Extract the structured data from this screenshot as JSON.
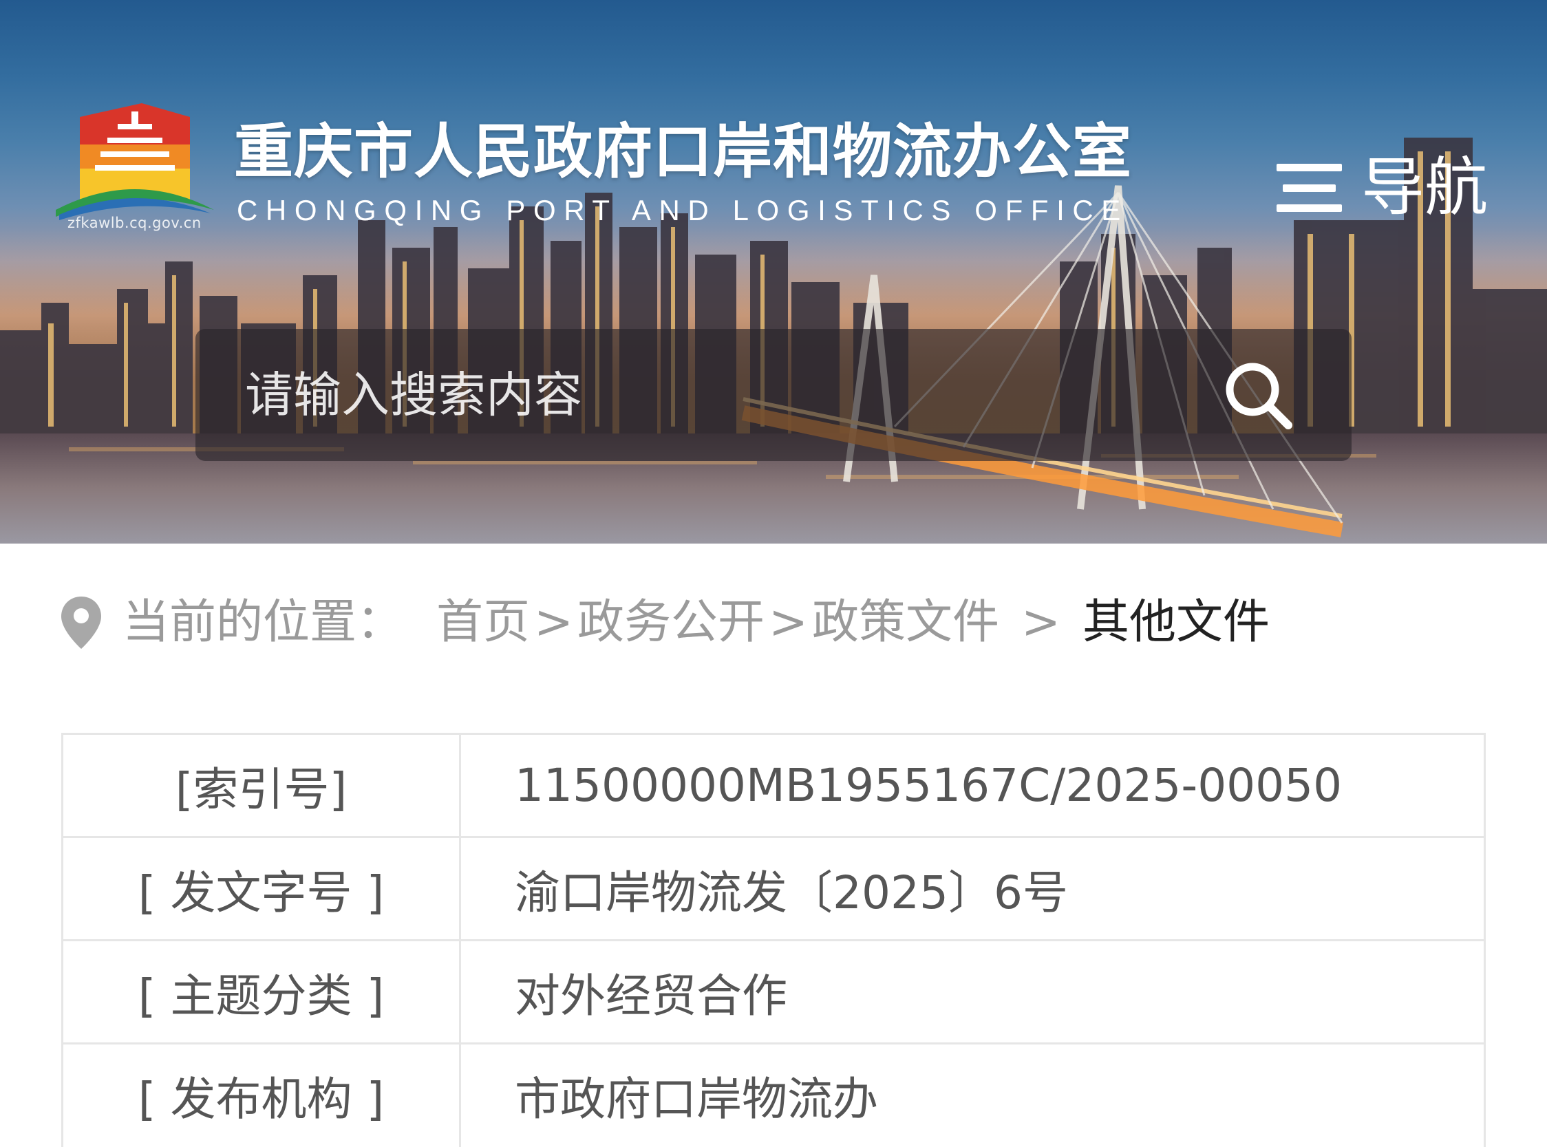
{
  "header": {
    "site_title": "重庆市人民政府口岸和物流办公室",
    "site_subtitle": "CHONGQING PORT AND LOGISTICS OFFICE",
    "logo_url_text": "zfkawlb.cq.gov.cn",
    "logo_icon": "government-emblem-logo",
    "nav_icon": "menu-icon",
    "nav_label": "导航"
  },
  "search": {
    "placeholder": "请输入搜索内容",
    "value": "",
    "icon": "search-icon"
  },
  "breadcrumb": {
    "icon": "location-pin-icon",
    "label": "当前的位置：",
    "items": [
      "首页",
      "政务公开",
      "政策文件",
      "其他文件"
    ],
    "separators": [
      ">",
      ">",
      ">"
    ]
  },
  "document_info": {
    "rows": [
      {
        "label": "[索引号]",
        "value": "11500000MB1955167C/2025-00050"
      },
      {
        "label": "[ 发文字号 ]",
        "value": "渝口岸物流发〔2025〕6号"
      },
      {
        "label": "[ 主题分类 ]",
        "value": "对外经贸合作"
      },
      {
        "label": "[ 发布机构 ]",
        "value": "市政府口岸物流办"
      }
    ]
  },
  "colors": {
    "breadcrumb_muted": "#9a9a9a",
    "breadcrumb_current": "#222222",
    "table_border": "#e6e6e6",
    "table_text": "#555555"
  }
}
